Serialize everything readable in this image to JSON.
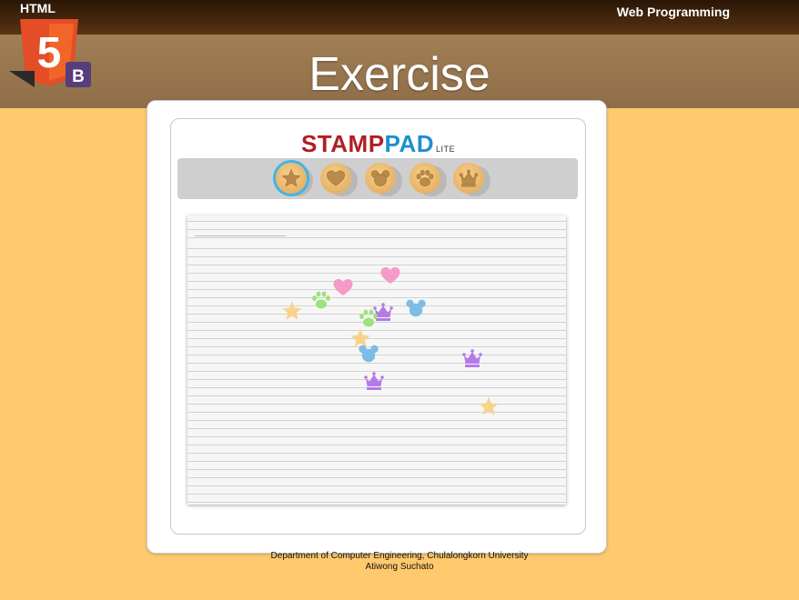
{
  "header": {
    "logo_text": "HTML",
    "logo_number": "5",
    "logo_badge": "B",
    "course": "Web Programming",
    "slide_title": "Exercise"
  },
  "app": {
    "brand_stamp": "STAMP",
    "brand_pad": "PAD",
    "brand_lite": "LITE",
    "tools": [
      {
        "name": "star",
        "icon": "star-icon",
        "active": true
      },
      {
        "name": "heart",
        "icon": "heart-icon",
        "active": false
      },
      {
        "name": "mouse",
        "icon": "mouse-head-icon",
        "active": false
      },
      {
        "name": "paw",
        "icon": "paw-icon",
        "active": false
      },
      {
        "name": "crown",
        "icon": "crown-icon",
        "active": false
      }
    ],
    "stamps": [
      {
        "type": "star",
        "color": "#f7d48a"
      },
      {
        "type": "paw",
        "color": "#9ee27a"
      },
      {
        "type": "heart",
        "color": "#f59ac9"
      },
      {
        "type": "heart",
        "color": "#f59ac9"
      },
      {
        "type": "mouse",
        "color": "#7cbce6"
      },
      {
        "type": "crown",
        "color": "#b47ae6"
      },
      {
        "type": "paw",
        "color": "#9ee27a"
      },
      {
        "type": "star",
        "color": "#f7d48a"
      },
      {
        "type": "mouse",
        "color": "#7cbce6"
      },
      {
        "type": "crown",
        "color": "#b47ae6"
      },
      {
        "type": "crown",
        "color": "#b47ae6"
      },
      {
        "type": "star",
        "color": "#f7d48a"
      }
    ]
  },
  "footer": {
    "line1": "Department  of Computer Engineering,  Chulalongkorn  University",
    "line2": "Atiwong Suchato"
  },
  "colors": {
    "background": "#ffc96e",
    "title_band": "#8f6d47",
    "brand_red": "#b01e24",
    "brand_blue": "#1e8fd0"
  }
}
